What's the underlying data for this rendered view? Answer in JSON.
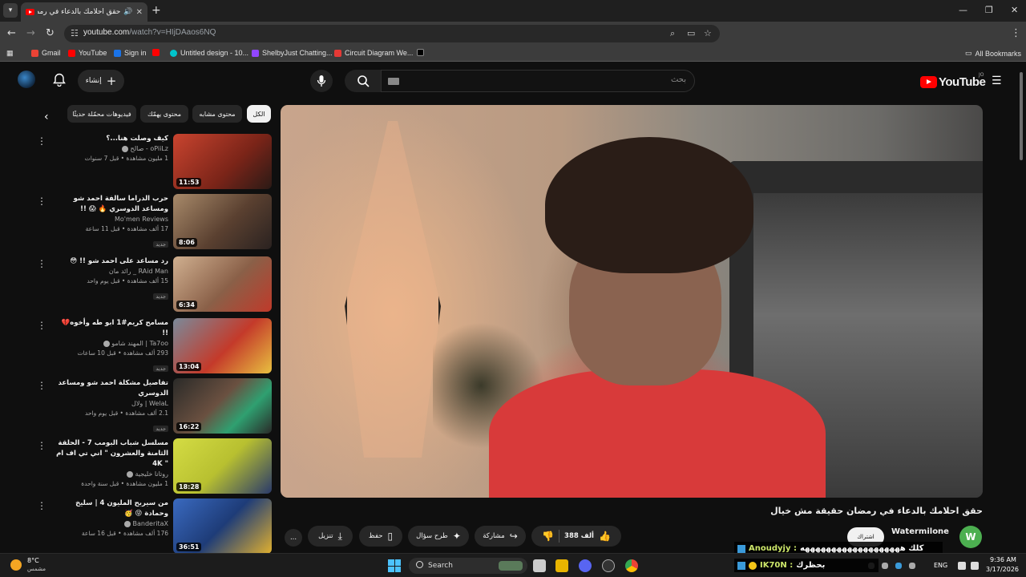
{
  "browser": {
    "tab_title": "حقق احلامك بالدعاء في رمضا...",
    "tab_audio_icon": "speaker-icon",
    "url_host": "youtube.com",
    "url_path": "/watch?v=HIjDAaos6NQ",
    "bookmarks": [
      {
        "label": "Gmail",
        "color": "#ea4335"
      },
      {
        "label": "YouTube",
        "color": "#ff0000"
      },
      {
        "label": "Sign in",
        "color": "#1a73e8"
      },
      {
        "label": "Untitled design - 10...",
        "color": "#00c4cc"
      },
      {
        "label": "ShelbyJust Chatting...",
        "color": "#9146ff"
      },
      {
        "label": "Circuit Diagram We...",
        "color": "#e53935"
      },
      {
        "label": "",
        "color": "#000000"
      }
    ],
    "all_bookmarks": "All Bookmarks"
  },
  "youtube": {
    "logo_text": "YouTube",
    "country": "JO",
    "search_placeholder": "بحث",
    "create_label": "إنشاء",
    "chips": [
      "الكل",
      "محتوى مشابه",
      "محتوى يهمّك",
      "فيديوهات محمّلة حديثًا"
    ],
    "recommendations": [
      {
        "title": "كيف وصلت هنا...؟",
        "channel": "oPiiLz - صالح",
        "stats": "1 مليون مشاهدة • قبل 7 سنوات",
        "duration": "11:53",
        "badge": "",
        "thumb": "#b33a2e"
      },
      {
        "title": "حرب الدراما سالفة احمد شو ومساعد الدوسري 🔥 😱 !!",
        "channel": "Mo'men Reviews",
        "stats": "17 ألف مشاهدة • قبل 11 ساعة",
        "duration": "8:06",
        "badge": "جديد",
        "thumb": "#8c6b4a"
      },
      {
        "title": "رد مساعد على احمد شو !! 😳",
        "channel": "RAid Man _ رائد مان",
        "stats": "15 ألف مشاهدة • قبل يوم واحد",
        "duration": "6:34",
        "badge": "جديد",
        "thumb": "#a07050"
      },
      {
        "title": "مسامح كريم#1 ابو طه وأخوه💔 !!",
        "channel": "Ta7oo | المهند شامو",
        "stats": "293 ألف مشاهدة • قبل 10 ساعات",
        "duration": "13:04",
        "badge": "جديد",
        "thumb": "#c23b2a"
      },
      {
        "title": "تفاصيل مشكلة احمد شو ومساعد الدوسري",
        "channel": "WelaL | ولال",
        "stats": "2.1 ألف مشاهدة • قبل يوم واحد",
        "duration": "16:22",
        "badge": "جديد",
        "thumb": "#4a3a30"
      },
      {
        "title": "مسلسل شباب البومب 7 - الحلقة الثامنة والعشرون \" اني تي اف ام \" 4K",
        "channel": "روتانا خليجية",
        "stats": "1 مليون مشاهدة • قبل سنة واحدة",
        "duration": "18:28",
        "badge": "",
        "thumb": "#c8d43a"
      },
      {
        "title": "من سيربح المليون 4 | سليخ وحمادة 😝 🥳",
        "channel": "BanderitaX",
        "stats": "176 ألف مشاهدة • قبل 16 ساعة",
        "duration": "36:51",
        "badge": "",
        "thumb": "#2c5aa0"
      }
    ],
    "video_title": "حقق احلامك بالدعاء في رمضان حقيقة مش خيال",
    "channel_name": "Watermilone",
    "channel_initial": "W",
    "subscribe_label": "اشتراك",
    "likes": "388 ألف",
    "share_label": "مشاركة",
    "ask_label": "طرح سؤال",
    "save_label": "حفظ",
    "download_label": "تنزيل",
    "more_label": "..."
  },
  "chat": [
    {
      "name": "Anoudyjy :",
      "message": "كلك هههههههههههههههههههه"
    },
    {
      "name": "IK70N :",
      "message": "بحظرك"
    }
  ],
  "taskbar": {
    "weather_temp": "8°C",
    "weather_desc": "مشمس",
    "search_label": "Search",
    "lang": "ENG",
    "time": "9:36 AM",
    "date": "3/17/2026"
  }
}
